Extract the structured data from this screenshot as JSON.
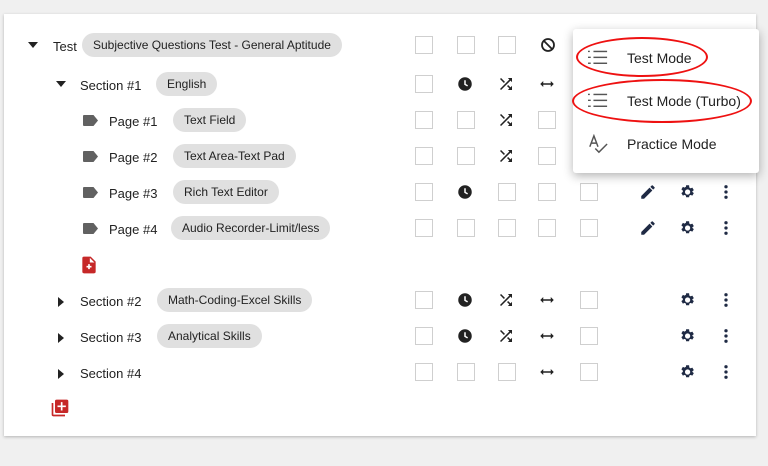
{
  "tree": {
    "test": {
      "label": "Test",
      "chip": "Subjective Questions Test - General Aptitude"
    },
    "section1": {
      "label": "Section #1",
      "chip": "English"
    },
    "pages": [
      {
        "label": "Page #1",
        "chip": "Text Field"
      },
      {
        "label": "Page #2",
        "chip": "Text Area-Text Pad"
      },
      {
        "label": "Page #3",
        "chip": "Rich Text Editor"
      },
      {
        "label": "Page #4",
        "chip": "Audio Recorder-Limit/less"
      }
    ],
    "section2": {
      "label": "Section #2",
      "chip": "Math-Coding-Excel Skills"
    },
    "section3": {
      "label": "Section #3",
      "chip": "Analytical Skills"
    },
    "section4": {
      "label": "Section #4"
    }
  },
  "menu": {
    "items": [
      {
        "label": "Test Mode",
        "icon": "numbered-list-icon"
      },
      {
        "label": "Test Mode (Turbo)",
        "icon": "numbered-list-icon"
      },
      {
        "label": "Practice Mode",
        "icon": "spellcheck-icon"
      }
    ]
  },
  "colors": {
    "accent_red": "#c62828",
    "icon_navy": "#1f2a44",
    "highlight_ring": "#e11111"
  }
}
